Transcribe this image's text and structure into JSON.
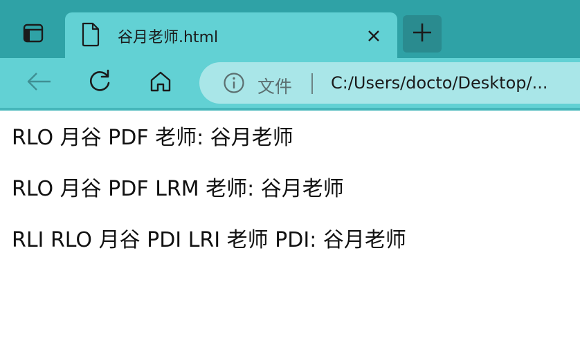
{
  "browser": {
    "tab": {
      "title": "谷月老师.html"
    },
    "toolbar": {
      "page_type_label": "文件",
      "url": "C:/Users/docto/Desktop/..."
    },
    "colors": {
      "tabstrip": "#2fa2a6",
      "active_tab": "#62d1d4",
      "toolbar": "#62d1d4",
      "addressbar": "#a9e6e8",
      "new_tab_button": "#2a8b8f"
    },
    "icons": {
      "tab_actions": "tab-actions-icon",
      "tab_file": "file-icon",
      "tab_close": "close-icon",
      "new_tab": "plus-icon",
      "back": "back-arrow-icon",
      "refresh": "refresh-icon",
      "home": "home-icon",
      "site_info": "info-icon"
    }
  },
  "page": {
    "lines": [
      "RLO 月谷 PDF 老师: 谷月老师",
      "RLO 月谷 PDF LRM 老师: 谷月老师",
      "RLI RLO 月谷 PDI LRI 老师 PDI: 谷月老师"
    ]
  }
}
